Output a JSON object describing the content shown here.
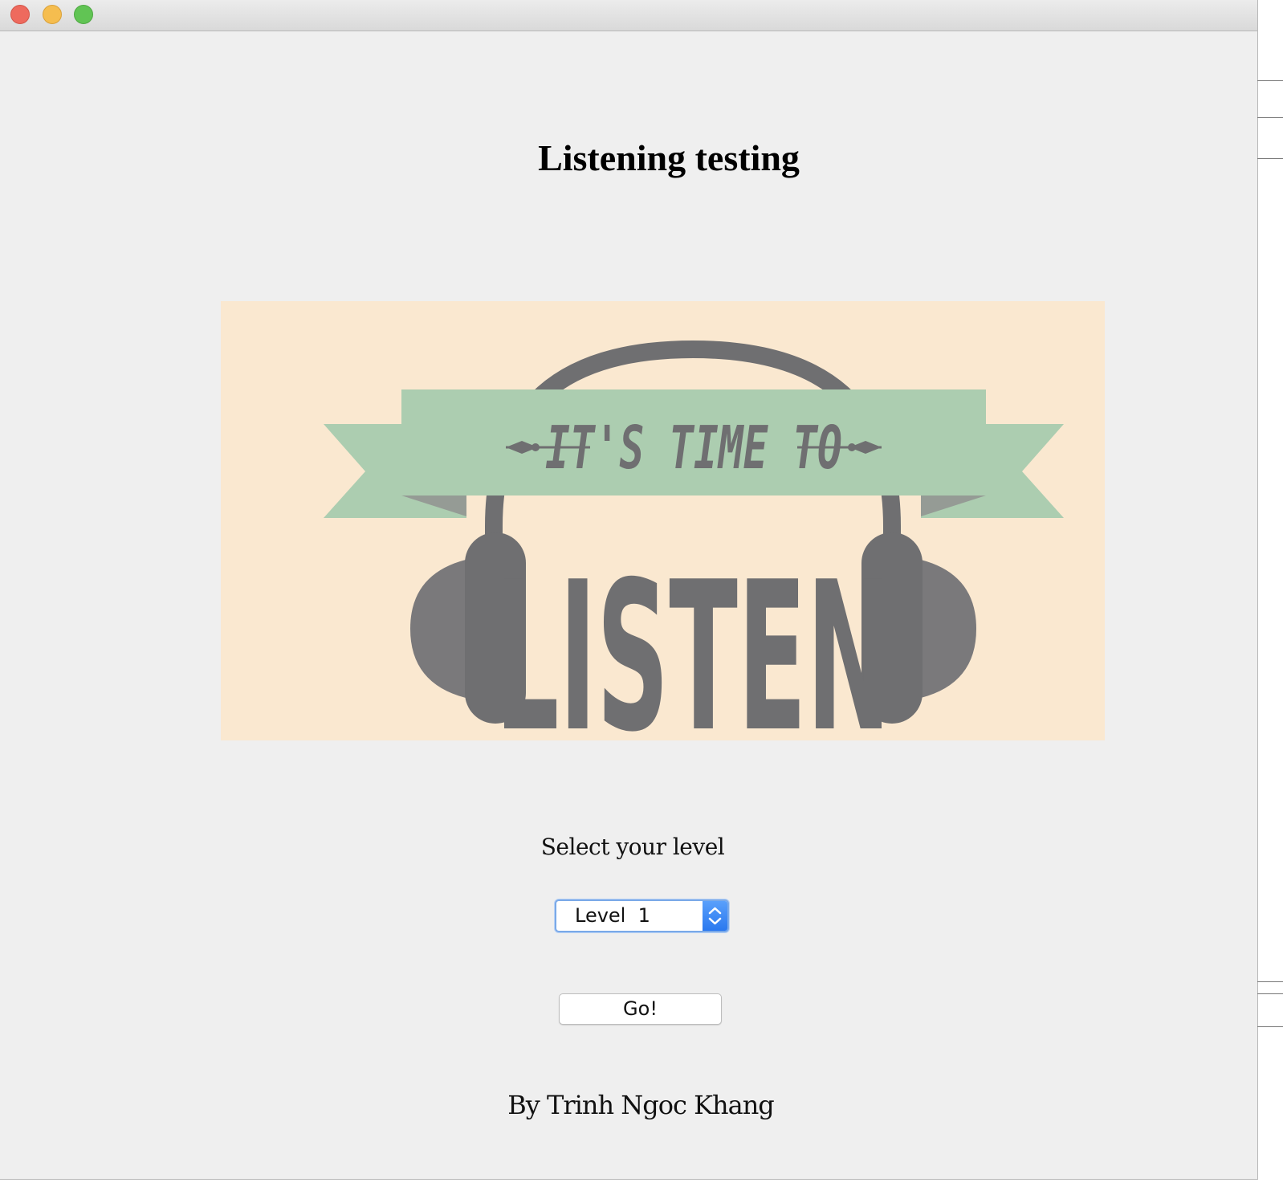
{
  "window": {
    "controls": [
      "close",
      "minimize",
      "zoom"
    ]
  },
  "header": {
    "title": "Listening testing"
  },
  "banner": {
    "tagline": "IT'S TIME TO",
    "headline": "LISTEN",
    "colors": {
      "background": "#fae8d0",
      "ribbon": "#accdb0",
      "ribbon_shade": "#959b95",
      "headphones": "#6f6f71"
    }
  },
  "form": {
    "select_label": "Select your level",
    "level_value": "Level  1",
    "go_label": "Go!"
  },
  "footer": {
    "author": "By Trinh Ngoc Khang"
  },
  "colors": {
    "window_bg": "#efefef",
    "select_accent": "#2a78ef"
  }
}
